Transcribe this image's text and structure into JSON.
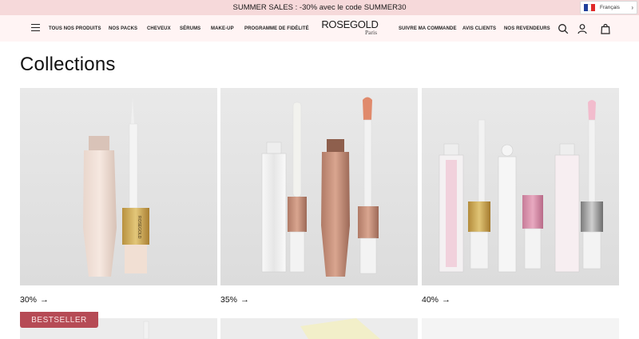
{
  "announcement": {
    "text": "SUMMER SALES : -30% avec le code SUMMER30"
  },
  "language": {
    "label": "Français",
    "flag_colors": [
      "#1f3f9b",
      "#ffffff",
      "#e02a2a"
    ]
  },
  "header": {
    "background": "#fff4f4",
    "nav_left": [
      "TOUS NOS PRODUITS",
      "NOS PACKS",
      "CHEVEUX",
      "SÉRUMS",
      "MAKE-UP",
      "PROGRAMME DE FIDÉLITÉ"
    ],
    "nav_right": [
      "SUIVRE MA COMMANDE",
      "AVIS CLIENTS",
      "NOS REVENDEURS"
    ],
    "logo": {
      "brand": "ROSEGOLD",
      "city": "Paris"
    },
    "icons": [
      "menu-icon",
      "search-icon",
      "account-icon",
      "bag-icon"
    ]
  },
  "main": {
    "title": "Collections",
    "cards": [
      {
        "label": "30%",
        "arrow": "→"
      },
      {
        "label": "35%",
        "arrow": "→"
      },
      {
        "label": "40%",
        "arrow": "→"
      }
    ],
    "badge": "BESTSELLER"
  },
  "colors": {
    "announcement_bg": "#f6d9da",
    "badge": "#b64b55"
  }
}
